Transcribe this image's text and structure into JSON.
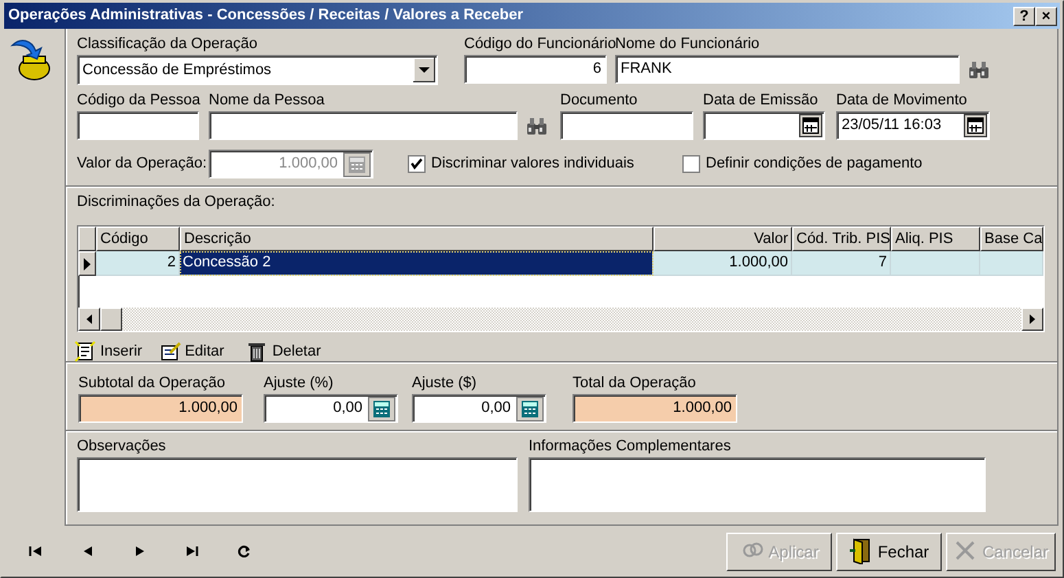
{
  "window": {
    "title": "Operações Administrativas - Concessões / Receitas / Valores a Receber",
    "title_buttons": [
      "?",
      "×"
    ]
  },
  "operation": {
    "fields": [
      {
        "label": "Classificação da Operação",
        "kind": "combo",
        "value": "Concessão de Empréstimos"
      },
      {
        "label": "Código do Funcionário",
        "kind": "text",
        "value": "6"
      },
      {
        "label": "Nome do Funcionário",
        "kind": "lookup",
        "value": "FRANK"
      },
      {
        "label": "Código da Pessoa",
        "kind": "text"
      },
      {
        "label": "Nome da Pessoa",
        "kind": "lookup"
      },
      {
        "label": "Documento",
        "kind": "text"
      },
      {
        "label": "Data de Emissão",
        "kind": "date"
      },
      {
        "label": "Data de Movimento",
        "kind": "date",
        "value": "23/05/11 16:03"
      }
    ],
    "value_field": {
      "label": "Valor da Operação:",
      "kind": "calc",
      "value": "1.000,00",
      "disabled": true
    },
    "checkboxes": [
      {
        "label": "Discriminar valores individuais",
        "checked": true
      },
      {
        "label": "Definir condições de pagamento",
        "checked": false
      }
    ]
  },
  "discriminations": {
    "title": "Discriminações da Operação:",
    "table": {
      "columns": [
        "Código",
        "Descrição",
        "Valor",
        "Cód. Trib. PIS",
        "Aliq. PIS",
        "Base Ca"
      ],
      "rows": [
        {
          "selected": true,
          "cells": [
            {
              "text": "2",
              "focused": false
            },
            {
              "text": "Concessão 2",
              "focused": true
            },
            {
              "text": "1.000,00",
              "focused": false
            },
            {
              "text": "7",
              "focused": false
            },
            {
              "text": "",
              "focused": false
            },
            {
              "text": "",
              "focused": false
            }
          ]
        }
      ]
    },
    "actions": [
      {
        "label": "Inserir",
        "kind": "insert"
      },
      {
        "label": "Editar",
        "kind": "edit"
      },
      {
        "label": "Deletar",
        "kind": "delete"
      }
    ]
  },
  "totals": [
    {
      "label": "Subtotal da Operação",
      "kind": "total",
      "value": "1.000,00"
    },
    {
      "label": "Ajuste (%)",
      "kind": "calc",
      "value": "0,00",
      "disabled": false
    },
    {
      "label": "Ajuste ($)",
      "kind": "calc",
      "value": "0,00",
      "disabled": false
    },
    {
      "label": "Total da Operação",
      "kind": "total",
      "value": "1.000,00"
    }
  ],
  "notes": [
    {
      "label": "Observações"
    },
    {
      "label": "Informações Complementares"
    }
  ],
  "navigation": [
    {
      "kind": "first"
    },
    {
      "kind": "previous"
    },
    {
      "kind": "next"
    },
    {
      "kind": "last"
    },
    {
      "kind": "refresh"
    }
  ],
  "buttons": [
    {
      "label": "Aplicar",
      "kind": "apply",
      "disabled": true
    },
    {
      "label": "Fechar",
      "kind": "close",
      "disabled": false
    },
    {
      "label": "Cancelar",
      "kind": "cancel",
      "disabled": true
    }
  ]
}
